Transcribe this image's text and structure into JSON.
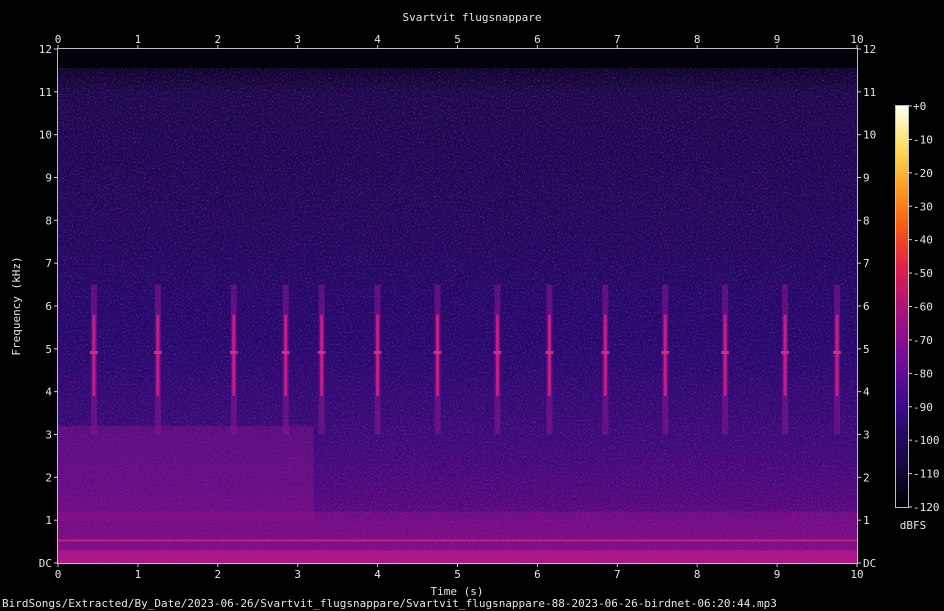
{
  "chart_data": {
    "type": "heatmap",
    "title": "Svartvit flugsnappare",
    "xlabel": "Time (s)",
    "ylabel": "Frequency (kHz)",
    "xlim": [
      0,
      10
    ],
    "ylim": [
      0,
      12
    ],
    "x_ticks": [
      "0",
      "1",
      "2",
      "3",
      "4",
      "5",
      "6",
      "7",
      "8",
      "9",
      "10"
    ],
    "y_ticks": [
      "DC",
      "1",
      "2",
      "3",
      "4",
      "5",
      "6",
      "7",
      "8",
      "9",
      "10",
      "11",
      "12"
    ],
    "colorbar": {
      "label": "dBFS",
      "range": [
        -120,
        0
      ],
      "ticks": [
        "+0",
        "-10",
        "-20",
        "-30",
        "-40",
        "-50",
        "-60",
        "-70",
        "-80",
        "-90",
        "-100",
        "-110",
        "-120"
      ],
      "colors": [
        "#000000",
        "#1a0845",
        "#3a0a8a",
        "#7a0c9a",
        "#b0127a",
        "#e0204a",
        "#f85a10",
        "#fca020",
        "#fde060",
        "#fffff0"
      ]
    },
    "song_elements": {
      "description_units": "seconds / kHz",
      "onsets_s": [
        0.45,
        1.25,
        2.2,
        2.85,
        3.3,
        4.0,
        4.75,
        5.5,
        6.15,
        6.85,
        7.6,
        8.35,
        9.1,
        9.75
      ],
      "freq_range_khz": [
        3.0,
        6.5
      ]
    },
    "footer_path": "BirdSongs/Extracted/By_Date/2023-06-26/Svartvit_flugsnappare/Svartvit_flugsnappare-88-2023-06-26-birdnet-06:20:44.mp3"
  }
}
